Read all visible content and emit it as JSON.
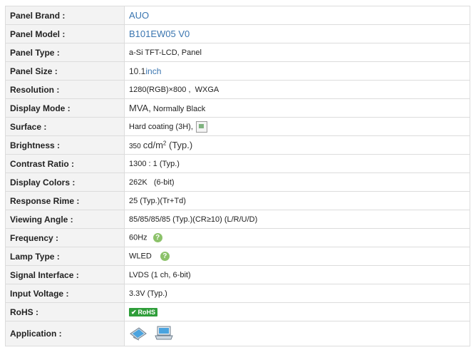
{
  "rows": [
    {
      "label": "Panel Brand :",
      "value": "AUO"
    },
    {
      "label": "Panel Model :",
      "value": "B101EW05 V0"
    },
    {
      "label": "Panel Type :",
      "value": "a-Si TFT-LCD, Panel"
    },
    {
      "label": "Panel Size :",
      "number": "10.1",
      "unit": "inch"
    },
    {
      "label": "Resolution :",
      "value": "1280(RGB)×800 ,  WXGA"
    },
    {
      "label": "Display Mode :",
      "main": "MVA,",
      "sub": " Normally Black"
    },
    {
      "label": "Surface :",
      "value": "Hard coating (3H),"
    },
    {
      "label": "Brightness :",
      "number": "350",
      "unit": "cd/m",
      "sup": "2",
      "note": " (Typ.)"
    },
    {
      "label": "Contrast Ratio :",
      "value": "1300 : 1 (Typ.)"
    },
    {
      "label": "Display Colors :",
      "value": "262K   (6-bit)"
    },
    {
      "label": "Response Rime :",
      "value": "25 (Typ.)(Tr+Td)"
    },
    {
      "label": "Viewing Angle :",
      "value": "85/85/85/85 (Typ.)(CR≥10) (L/R/U/D)"
    },
    {
      "label": "Frequency :",
      "value": "60Hz"
    },
    {
      "label": "Lamp Type :",
      "value": "WLED"
    },
    {
      "label": "Signal Interface :",
      "value": "LVDS (1 ch, 6-bit)"
    },
    {
      "label": "Input Voltage :",
      "value": "3.3V (Typ.)"
    },
    {
      "label": "RoHS :",
      "badge": "RoHS"
    },
    {
      "label": "Application :"
    }
  ],
  "icons": {
    "help": "question-icon",
    "surface": "broken-image-icon",
    "rohs": "check-icon",
    "app1": "tablet-icon",
    "app2": "laptop-icon"
  },
  "help_glyph": "?",
  "colors": {
    "label_bg": "#f3f3f3",
    "link": "#3a75b0",
    "help": "#8cc26a",
    "rohs": "#2f9e3a",
    "border": "#dcdcdc"
  }
}
